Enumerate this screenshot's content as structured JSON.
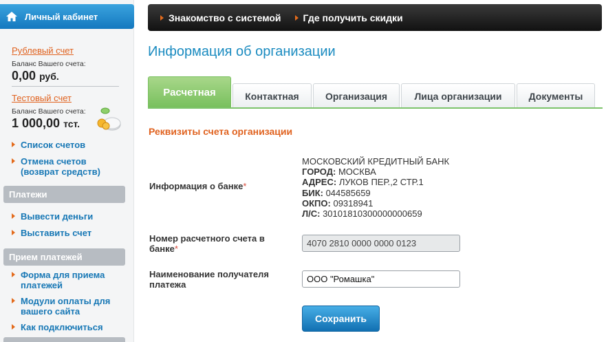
{
  "sidebar": {
    "header": "Личный кабинет",
    "rub_account": {
      "link": "Рублевый счет",
      "balance_label": "Баланс Вашего счета:",
      "balance_value": "0,00",
      "currency": "руб."
    },
    "test_account": {
      "link": "Тестовый счет",
      "balance_label": "Баланс Вашего счета:",
      "balance_value": "1 000,00",
      "currency": "тст."
    },
    "account_links": [
      "Список счетов",
      "Отмена счетов (возврат средств)"
    ],
    "payments": {
      "title": "Платежи",
      "links": [
        "Вывести деньги",
        "Выставить счет"
      ]
    },
    "receiving": {
      "title": "Прием платежей",
      "links": [
        "Форма для приема платежей",
        "Модули оплаты для вашего сайта",
        "Как подключиться"
      ]
    }
  },
  "topnav": {
    "items": [
      "Знакомство с системой",
      "Где получить скидки"
    ]
  },
  "page_title": "Информация об организации",
  "tabs": [
    "Расчетная",
    "Контактная",
    "Организация",
    "Лица организации",
    "Документы"
  ],
  "section_title": "Реквизиты счета организации",
  "form": {
    "bank_info_label": "Информация о банке",
    "bank_info": {
      "name": "МОСКОВСКИЙ КРЕДИТНЫЙ БАНК",
      "city_label": "ГОРОД:",
      "city": "МОСКВА",
      "address_label": "АДРЕС:",
      "address": "ЛУКОВ ПЕР.,2 СТР.1",
      "bik_label": "БИК:",
      "bik": "044585659",
      "okpo_label": "ОКПО:",
      "okpo": "09318941",
      "ls_label": "Л/С:",
      "ls": "30101810300000000659"
    },
    "account_label": "Номер расчетного счета в банке",
    "account_value": "4070 2810 0000 0000 0123",
    "recipient_label": "Наименование получателя платежа",
    "recipient_value": "ООО \"Ромашка\"",
    "required_mark": "*"
  },
  "save_button": "Сохранить",
  "colors": {
    "accent_blue": "#1a8bc0",
    "accent_orange": "#e0621f",
    "tab_active_green": "#77bf5d"
  }
}
